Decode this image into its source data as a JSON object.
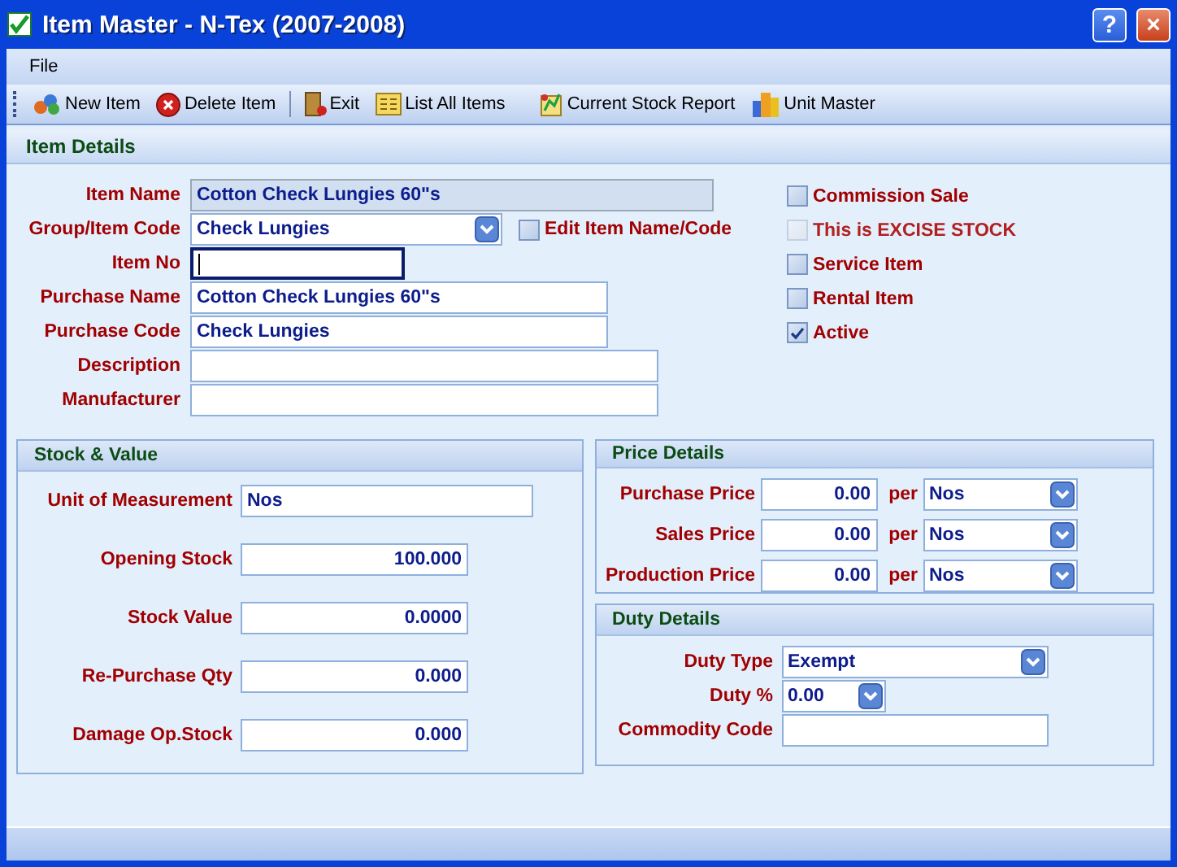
{
  "window": {
    "title": "Item Master - N-Tex (2007-2008)",
    "help": "?",
    "close": "×"
  },
  "menu": [
    "File"
  ],
  "toolbar": [
    {
      "label": "New Item",
      "kind": "new"
    },
    {
      "label": "Delete Item",
      "kind": "delete"
    },
    {
      "label": "Exit",
      "kind": "exit"
    },
    {
      "label": "List All Items",
      "kind": "list"
    },
    {
      "label": "Current Stock Report",
      "kind": "report"
    },
    {
      "label": "Unit Master",
      "kind": "unit"
    }
  ],
  "item_details": {
    "title": "Item Details",
    "fields": [
      {
        "label": "Item Name",
        "kind": "text",
        "value": "Cotton Check Lungies 60\"s",
        "disabled": true,
        "focused": false
      },
      {
        "label": "Group/Item Code",
        "kind": "combo",
        "value": "Check Lungies",
        "disabled": false,
        "focused": false,
        "option": {
          "label": "Edit Item Name/Code",
          "checked": false
        }
      },
      {
        "label": "Item No",
        "kind": "text",
        "disabled": false,
        "focused": true
      },
      {
        "label": "Purchase Name",
        "kind": "text",
        "value": "Cotton Check Lungies 60\"s",
        "disabled": false,
        "focused": false
      },
      {
        "label": "Purchase Code",
        "kind": "text",
        "value": "Check Lungies",
        "disabled": false,
        "focused": false
      },
      {
        "label": "Description",
        "kind": "text",
        "disabled": false,
        "focused": false
      },
      {
        "label": "Manufacturer",
        "kind": "text",
        "disabled": false,
        "focused": false
      }
    ],
    "options": [
      {
        "label": "Commission Sale",
        "checked": false,
        "disabled": false
      },
      {
        "label": "This is EXCISE STOCK",
        "checked": false,
        "disabled": true
      },
      {
        "label": "Service Item",
        "checked": false,
        "disabled": false
      },
      {
        "label": "Rental Item",
        "checked": false,
        "disabled": false
      },
      {
        "label": "Active",
        "checked": true,
        "disabled": false
      }
    ]
  },
  "stock_value": {
    "title": "Stock & Value",
    "unit": {
      "label": "Unit of Measurement",
      "value": "Nos"
    },
    "fields": [
      {
        "label": "Opening Stock",
        "value": "100.000"
      },
      {
        "label": "Stock Value",
        "value": "0.0000"
      },
      {
        "label": "Re-Purchase Qty",
        "value": "0.000"
      },
      {
        "label": "Damage Op.Stock",
        "value": "0.000"
      }
    ]
  },
  "price_details": {
    "title": "Price Details",
    "rows": [
      {
        "label": "Purchase Price",
        "value": "0.00",
        "per": "per",
        "unit": "Nos"
      },
      {
        "label": "Sales Price",
        "value": "0.00",
        "per": "per",
        "unit": "Nos"
      },
      {
        "label": "Production Price",
        "value": "0.00",
        "per": "per",
        "unit": "Nos"
      }
    ]
  },
  "duty_details": {
    "title": "Duty Details",
    "fields": [
      {
        "label": "Duty Type",
        "kind": "combo",
        "value": "Exempt"
      },
      {
        "label": "Duty %",
        "kind": "combo",
        "value": "0.00"
      },
      {
        "label": "Commodity Code",
        "kind": "text"
      }
    ]
  }
}
